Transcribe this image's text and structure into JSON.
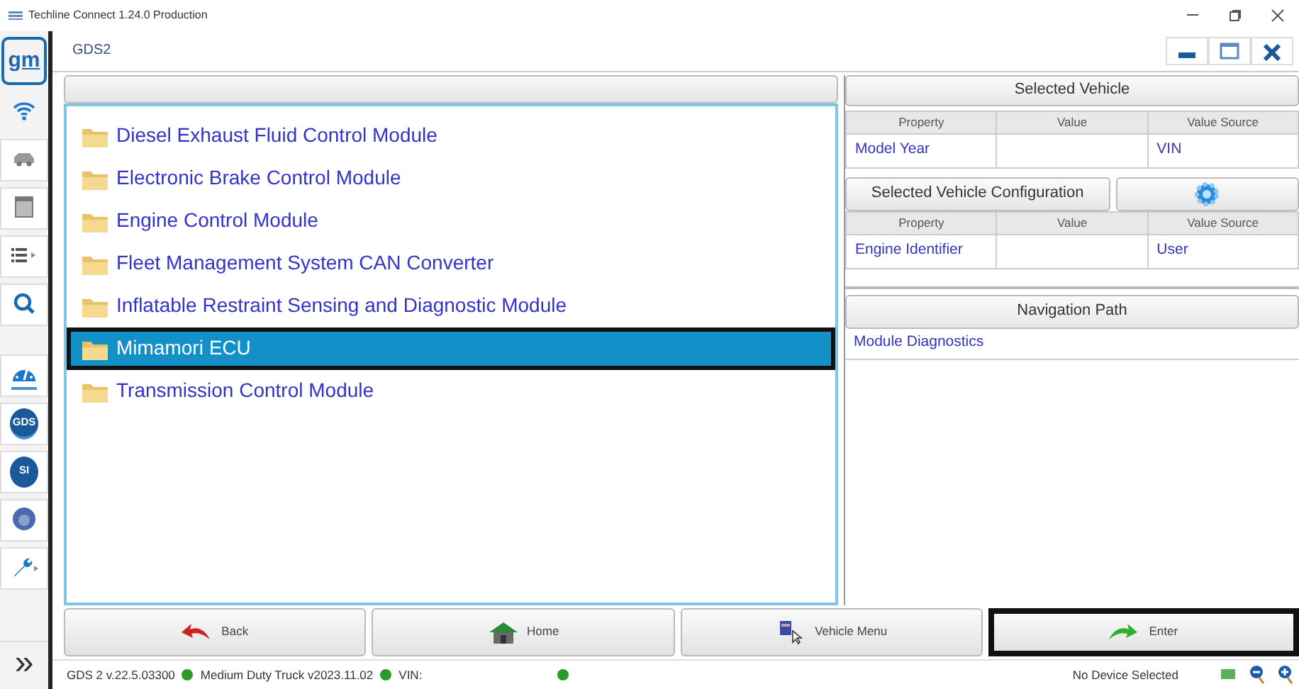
{
  "window": {
    "title": "Techline Connect 1.24.0 Production"
  },
  "sidebar": {
    "items": [
      {
        "kind": "logo",
        "label": "gm",
        "selected": false
      },
      {
        "kind": "wifi",
        "selected": false
      },
      {
        "kind": "car",
        "selected": false
      },
      {
        "kind": "box",
        "selected": false
      },
      {
        "kind": "list",
        "selected": false
      },
      {
        "kind": "search",
        "selected": false
      },
      {
        "kind": "gauge",
        "selected": true
      },
      {
        "kind": "badge",
        "label": "GDS",
        "selected": true
      },
      {
        "kind": "badge",
        "label": "SI",
        "selected": false
      },
      {
        "kind": "disc",
        "selected": false
      },
      {
        "kind": "wrench",
        "selected": false
      }
    ],
    "expand": "»"
  },
  "app": {
    "title": "GDS2"
  },
  "modules": [
    {
      "label": "Diesel Exhaust Fluid Control Module",
      "selected": false,
      "highlighted": false
    },
    {
      "label": "Electronic Brake Control Module",
      "selected": false,
      "highlighted": false
    },
    {
      "label": "Engine Control Module",
      "selected": false,
      "highlighted": false
    },
    {
      "label": "Fleet Management System CAN Converter",
      "selected": false,
      "highlighted": false
    },
    {
      "label": "Inflatable Restraint Sensing and Diagnostic Module",
      "selected": false,
      "highlighted": false
    },
    {
      "label": "Mimamori ECU",
      "selected": true,
      "highlighted": true
    },
    {
      "label": "Transmission Control Module",
      "selected": false,
      "highlighted": false
    }
  ],
  "selected_vehicle": {
    "title": "Selected Vehicle",
    "columns": [
      "Property",
      "Value",
      "Value Source"
    ],
    "rows": [
      [
        "Model Year",
        "",
        "VIN"
      ]
    ]
  },
  "vehicle_configuration": {
    "title": "Selected Vehicle Configuration",
    "columns": [
      "Property",
      "Value",
      "Value Source"
    ],
    "rows": [
      [
        "Engine Identifier",
        "",
        "User"
      ]
    ]
  },
  "navigation_path": {
    "title": "Navigation Path",
    "items": [
      "Module Diagnostics"
    ]
  },
  "buttons": [
    {
      "kind": "back",
      "label": "Back",
      "highlighted": false
    },
    {
      "kind": "home",
      "label": "Home",
      "highlighted": false
    },
    {
      "kind": "menu",
      "label": "Vehicle Menu",
      "highlighted": false
    },
    {
      "kind": "enter",
      "label": "Enter",
      "highlighted": true
    }
  ],
  "status_bar": {
    "version": "GDS 2 v.22.5.03300",
    "vehicle": "Medium Duty Truck v2023.11.02",
    "vin_label": "VIN:",
    "device": "No Device Selected"
  }
}
